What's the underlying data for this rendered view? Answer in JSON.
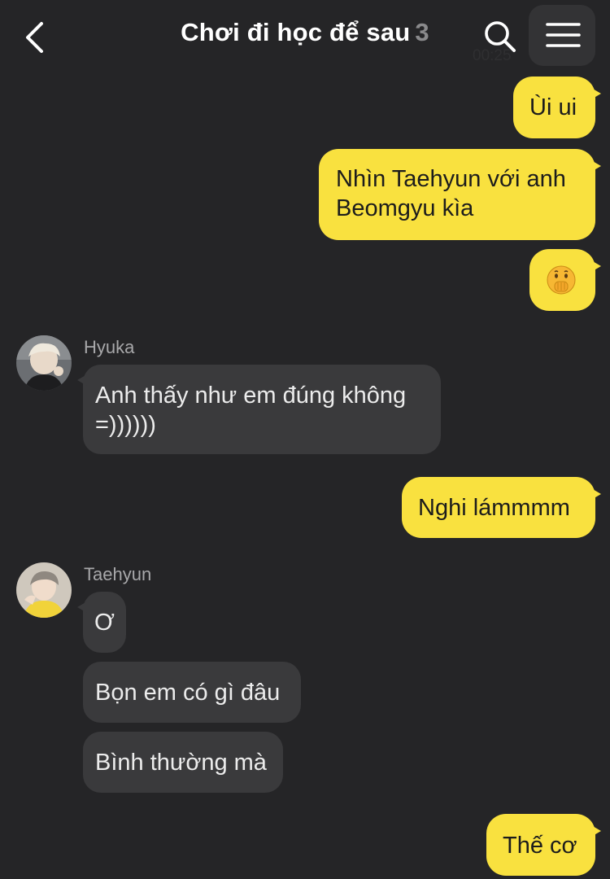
{
  "header": {
    "title": "Chơi đi học để sau",
    "member_count": "3",
    "back_icon": "chevron-left-icon",
    "search_icon": "search-icon",
    "menu_icon": "hamburger-menu-icon",
    "ghost_time": "00:25"
  },
  "colors": {
    "background": "#252527",
    "outgoing_bubble": "#f9e13f",
    "incoming_bubble": "#3a3a3c",
    "sender_name": "#a8a8aa"
  },
  "messages": {
    "m1": {
      "text": "Ùi ui"
    },
    "m2": {
      "line1": "Nhìn Taehyun với anh",
      "line2": "Beomgyu kìa"
    },
    "m3": {
      "emoji": "hand-over-mouth-emoji"
    },
    "hyuka": {
      "sender": "Hyuka",
      "line1": "Anh thấy như em đúng không",
      "line2": "=))))))"
    },
    "m5": {
      "text": "Nghi lámmmm"
    },
    "taehyun": {
      "sender": "Taehyun",
      "msg1": "Ơ",
      "msg2": "Bọn em có gì đâu",
      "msg3": "Bình thường mà"
    },
    "m7": {
      "text": "Thế cơ"
    }
  }
}
